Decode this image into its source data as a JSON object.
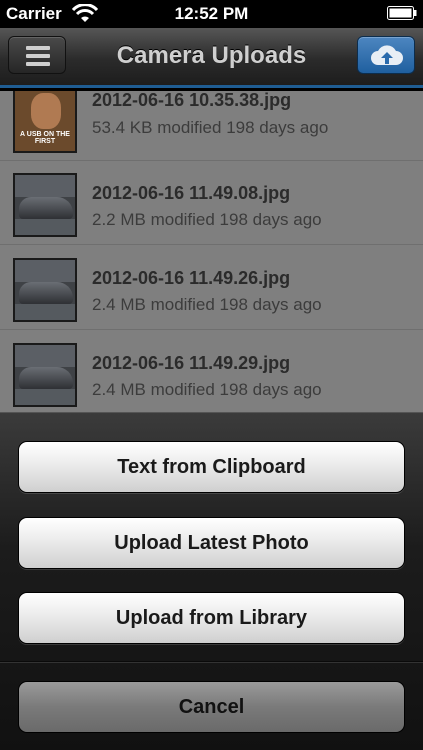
{
  "status_bar": {
    "carrier": "Carrier",
    "time": "12:52 PM",
    "wifi_icon": "wifi-icon",
    "battery_icon": "battery-icon"
  },
  "nav": {
    "title": "Camera Uploads",
    "menu_icon": "hamburger-menu-icon",
    "upload_icon": "cloud-upload-icon",
    "upload_color": "#2a6aac"
  },
  "files": [
    {
      "name": "2012-06-16 10.35.38.jpg",
      "meta": "53.4 KB modified 198 days ago",
      "thumb_caption": "A USB ON THE FIRST"
    },
    {
      "name": "2012-06-16 11.49.08.jpg",
      "meta": "2.2 MB modified 198 days ago"
    },
    {
      "name": "2012-06-16 11.49.26.jpg",
      "meta": "2.4 MB modified 198 days ago"
    },
    {
      "name": "2012-06-16 11.49.29.jpg",
      "meta": "2.4 MB modified 198 days ago"
    }
  ],
  "action_sheet": {
    "buttons": [
      "Text from Clipboard",
      "Upload Latest Photo",
      "Upload from Library"
    ],
    "cancel": "Cancel"
  }
}
